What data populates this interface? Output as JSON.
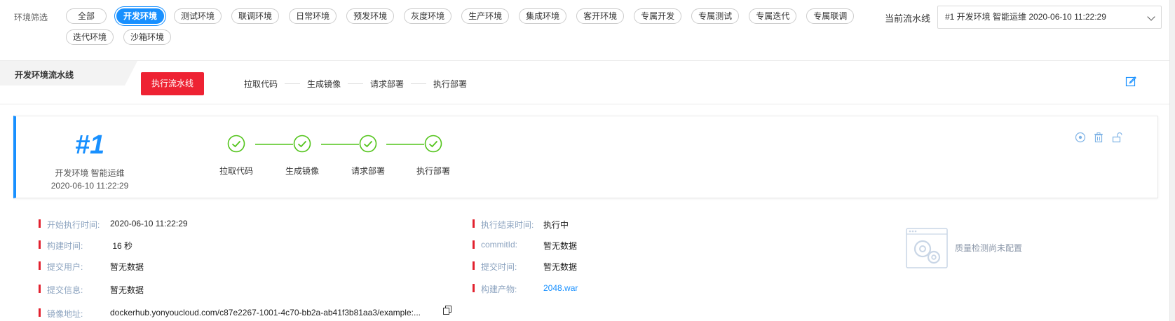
{
  "filter": {
    "label": "环境筛选",
    "chips": [
      "全部",
      "开发环境",
      "测试环境",
      "联调环境",
      "日常环境",
      "预发环境",
      "灰度环境",
      "生产环境",
      "集成环境",
      "客开环境",
      "专属开发",
      "专属测试",
      "专属迭代",
      "专属联调",
      "迭代环境",
      "沙箱环境"
    ],
    "active_index": 1
  },
  "current_pipeline": {
    "label": "当前流水线",
    "value": "#1 开发环境 智能运维 2020-06-10 11:22:29"
  },
  "pipeline_header": {
    "title": "开发环境流水线",
    "run_button": "执行流水线",
    "stages": [
      "拉取代码",
      "生成镜像",
      "请求部署",
      "执行部署"
    ]
  },
  "run": {
    "number": "#1",
    "name": "开发环境 智能运维",
    "time": "2020-06-10 11:22:29",
    "steps": [
      "拉取代码",
      "生成镜像",
      "请求部署",
      "执行部署"
    ],
    "step_status": "success"
  },
  "details_left": [
    {
      "key": "开始执行时间:",
      "value": "2020-06-10 11:22:29"
    },
    {
      "key": "构建时间:",
      "value": " 16 秒"
    },
    {
      "key": "提交用户:",
      "value": "暂无数据"
    },
    {
      "key": "提交信息:",
      "value": "暂无数据"
    },
    {
      "key": "镜像地址:",
      "value": "dockerhub.yonyoucloud.com/c87e2267-1001-4c70-bb2a-ab41f3b81aa3/example:..."
    }
  ],
  "details_right": [
    {
      "key": "执行结束时间:",
      "value": "执行中"
    },
    {
      "key": "commitId:",
      "value": "暂无数据"
    },
    {
      "key": "提交时间:",
      "value": "暂无数据"
    },
    {
      "key": "构建产物:",
      "value": "2048.war"
    }
  ],
  "quality": {
    "text": "质量检测尚未配置",
    "icon": "quality-gear-icon"
  },
  "colors": {
    "accent": "#1890ff",
    "danger": "#ee2233",
    "success": "#52c41a",
    "muted_key": "#8da4c0"
  }
}
